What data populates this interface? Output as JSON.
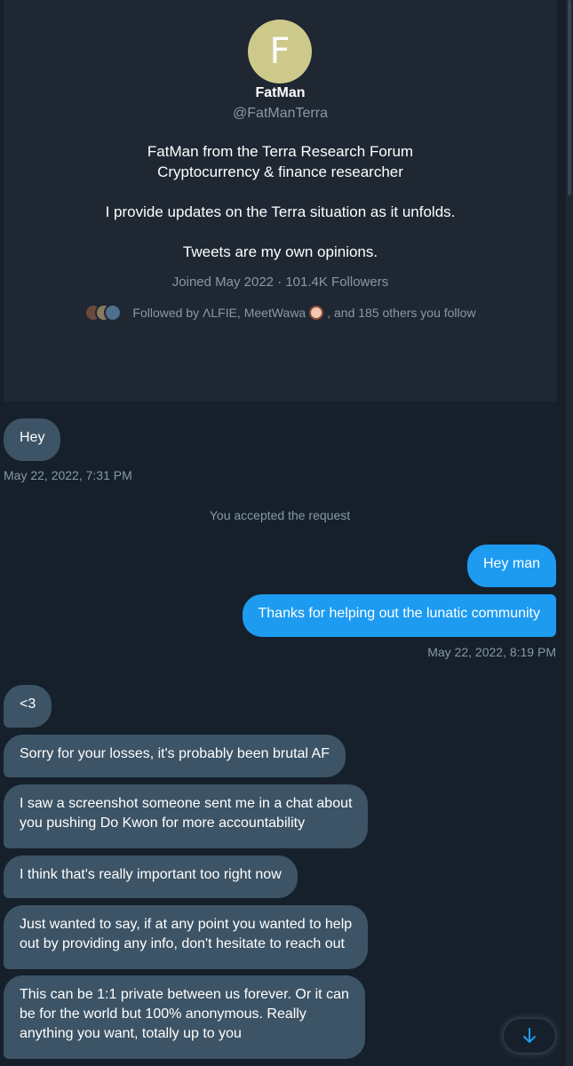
{
  "profile": {
    "avatar_letter": "F",
    "avatar_color": "#cdc98b",
    "name": "FatMan",
    "handle": "@FatManTerra",
    "bio": {
      "line1": "FatMan from the Terra Research Forum",
      "line2": "Cryptocurrency & finance researcher",
      "line3": "I provide updates on the Terra situation as it unfolds.",
      "line4": "Tweets are my own opinions."
    },
    "meta": "Joined May 2022 · 101.4K Followers",
    "followed_by_prefix": "Followed by ΛLFIE, MeetWawa",
    "followed_by_suffix": ", and 185 others you follow"
  },
  "messages": {
    "m1": "Hey",
    "m1_time": "May 22, 2022, 7:31 PM",
    "system": "You accepted the request",
    "m2": "Hey man",
    "m3": "Thanks for helping out the lunatic community",
    "m3_time": "May 22, 2022, 8:19 PM",
    "m4": "<3",
    "m5": "Sorry for your losses, it's probably been brutal AF",
    "m6": {
      "l1": "I saw a screenshot someone sent me in a chat about",
      "l2": "you pushing Do Kwon for more accountability"
    },
    "m7": "I think that's really important too right now",
    "m8": {
      "l1": "Just wanted to say, if at any point you wanted to help",
      "l2": "out by providing any info, don't hesitate to reach out"
    },
    "m9": {
      "l1": "This can be 1:1 private between us forever. Or it can",
      "l2": "be for the world but 100% anonymous. Really",
      "l3": "anything you want, totally up to you"
    }
  },
  "colors": {
    "background": "#15202b",
    "card": "#1e2732",
    "incoming_bubble": "#3d5466",
    "outgoing_bubble": "#1d9bf0",
    "secondary_text": "#8899a6"
  },
  "icons": {
    "scroll_down": "arrow-down-icon"
  }
}
